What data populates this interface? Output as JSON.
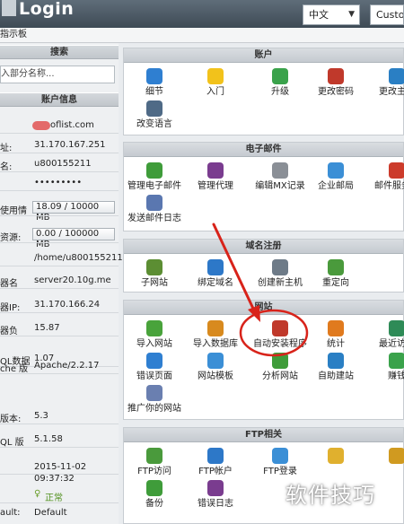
{
  "header": {
    "title": "Login",
    "language": "中文",
    "custom": "Custom",
    "subnav": "指示板"
  },
  "left": {
    "search_head": "搜索",
    "search_placeholder": "入部分名称...",
    "info_head": "账户信息",
    "rows": [
      {
        "k": "",
        "v": "oflist.com"
      },
      {
        "k": "址:",
        "v": "31.170.167.251"
      },
      {
        "k": "名:",
        "v": "u800155211"
      },
      {
        "k": "",
        "v": "•••••••••"
      },
      {
        "k": "使用情",
        "v": "18.09 / 10000 MB"
      },
      {
        "k": "资源:",
        "v": "0.00 / 100000 MB"
      },
      {
        "k": "",
        "v": "/home/u800155211"
      },
      {
        "k": "器名",
        "v": "server20.10g.me"
      },
      {
        "k": "器IP:",
        "v": "31.170.166.24"
      },
      {
        "k": "器负",
        "v": "15.87"
      },
      {
        "k": "QL数据",
        "v": "1.07"
      },
      {
        "k": "che 版",
        "v": "Apache/2.2.17"
      },
      {
        "k": "版本:",
        "v": "5.3"
      },
      {
        "k": "QL 版",
        "v": "5.1.58"
      },
      {
        "k": "",
        "v": "2015-11-02 09:37:32"
      },
      {
        "k": "",
        "v": "正常"
      },
      {
        "k": "ault:",
        "v": "Default"
      }
    ]
  },
  "panels": [
    {
      "title": "账户",
      "items": [
        {
          "label": "细节",
          "icon": "info-icon",
          "color": "#2f7fd1"
        },
        {
          "label": "入门",
          "icon": "lightbulb-icon",
          "color": "#f2c21b"
        },
        {
          "label": "升级",
          "icon": "upgrade-icon",
          "color": "#3aa24b"
        },
        {
          "label": "更改密码",
          "icon": "lock-icon",
          "color": "#c0392b"
        },
        {
          "label": "更改主页",
          "icon": "refresh-icon",
          "color": "#2a7fc4"
        },
        {
          "label": "改变语言",
          "icon": "language-icon",
          "color": "#4f6a86"
        }
      ]
    },
    {
      "title": "电子邮件",
      "items": [
        {
          "label": "管理电子邮件",
          "icon": "mail-manage-icon",
          "color": "#3f9c3a"
        },
        {
          "label": "管理代理",
          "icon": "agent-icon",
          "color": "#7a3c8f"
        },
        {
          "label": "编辑MX记录",
          "icon": "mx-icon",
          "color": "#8a8f96"
        },
        {
          "label": "企业邮局",
          "icon": "enterprise-mail-icon",
          "color": "#3b8fd6"
        },
        {
          "label": "邮件服务器",
          "icon": "mail-server-icon",
          "color": "#cc3b2b"
        },
        {
          "label": "发送邮件日志",
          "icon": "mail-log-icon",
          "color": "#5a77b0"
        }
      ]
    },
    {
      "title": "域名注册",
      "items": [
        {
          "label": "子网站",
          "icon": "subdomain-icon",
          "color": "#5c8e33"
        },
        {
          "label": "绑定域名",
          "icon": "park-domain-icon",
          "color": "#2d78c8"
        },
        {
          "label": "创建新主机",
          "icon": "new-host-icon",
          "color": "#6e7b88"
        },
        {
          "label": "重定向",
          "icon": "redirect-icon",
          "color": "#4a9a3c"
        }
      ]
    },
    {
      "title": "网站",
      "items": [
        {
          "label": "导入网站",
          "icon": "import-site-icon",
          "color": "#49a33b"
        },
        {
          "label": "导入数据库",
          "icon": "database-icon",
          "color": "#d88a1e"
        },
        {
          "label": "自动安装程序",
          "icon": "auto-installer-icon",
          "color": "#c0392b"
        },
        {
          "label": "统计",
          "icon": "stats-icon",
          "color": "#e07a1e"
        },
        {
          "label": "最近访问",
          "icon": "recent-visits-icon",
          "color": "#2e8b57"
        },
        {
          "label": "错误页面",
          "icon": "error-page-icon",
          "color": "#2f7fd1"
        },
        {
          "label": "网站模板",
          "icon": "templates-icon",
          "color": "#3b8fd6"
        },
        {
          "label": "分析网站",
          "icon": "analyze-icon",
          "color": "#3f9c3a"
        },
        {
          "label": "自助建站",
          "icon": "site-builder-icon",
          "color": "#2a7fc4"
        },
        {
          "label": "赚钱",
          "icon": "money-icon",
          "color": "#3aa24b"
        },
        {
          "label": "推广你的网站",
          "icon": "promote-icon",
          "color": "#6a7fb0"
        }
      ]
    },
    {
      "title": "FTP相关",
      "items": [
        {
          "label": "FTP访问",
          "icon": "ftp-access-icon",
          "color": "#4a9a3c"
        },
        {
          "label": "FTP帐户",
          "icon": "ftp-account-icon",
          "color": "#2d78c8"
        },
        {
          "label": "FTP登录",
          "icon": "ftp-login-icon",
          "color": "#3b8fd6"
        },
        {
          "label": "",
          "icon": "folder-icon",
          "color": "#e0b02e"
        },
        {
          "label": "",
          "icon": "folder-icon",
          "color": "#d09a20"
        },
        {
          "label": "备份",
          "icon": "backup-icon",
          "color": "#3f9c3a"
        },
        {
          "label": "错误日志",
          "icon": "error-log-icon",
          "color": "#7a3c8f"
        }
      ]
    }
  ],
  "watermark": "软件技巧"
}
